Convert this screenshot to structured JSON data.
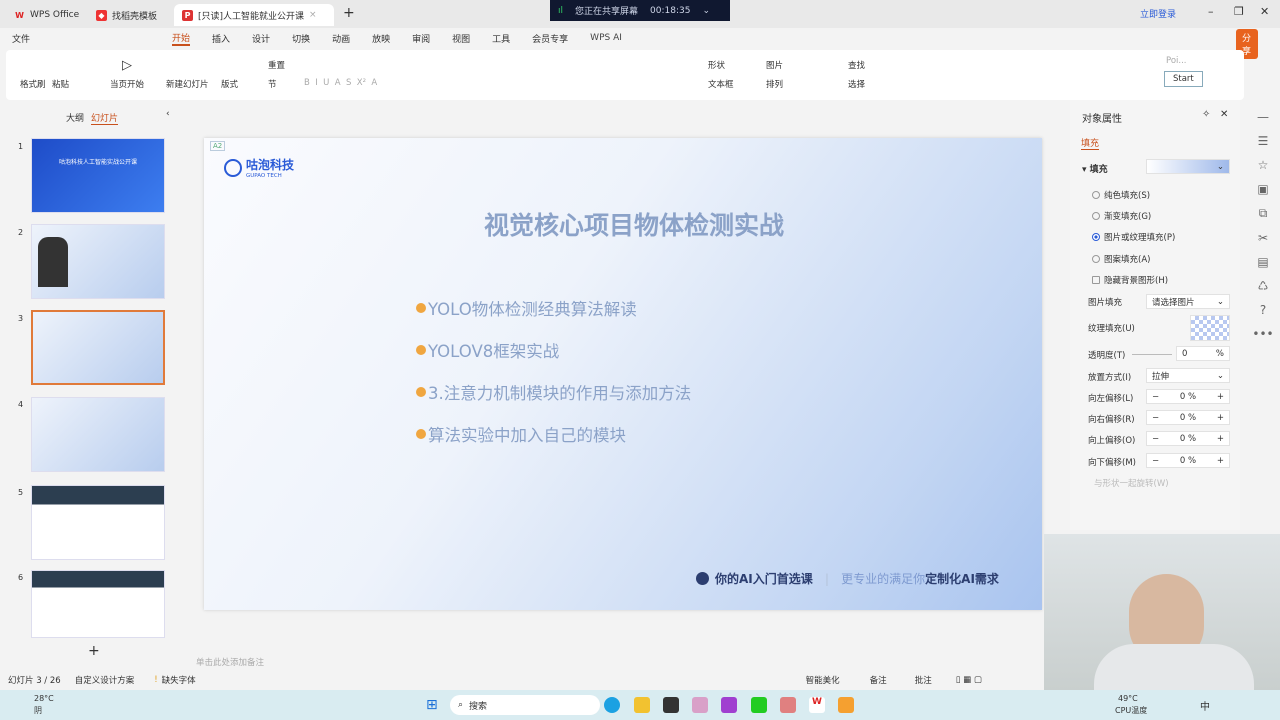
{
  "tabs": [
    {
      "label": "WPS Office",
      "icon": "wps-icon"
    },
    {
      "label": "找稻壳模板",
      "icon": "docer-icon"
    },
    {
      "label": "[只读]人工智能就业公开课",
      "icon": "ppt-icon"
    }
  ],
  "share_bar": {
    "text": "您正在共享屏幕",
    "time": "00:18:35"
  },
  "login": "立即登录",
  "share_button": "分享",
  "menu": [
    "文件",
    "开始",
    "插入",
    "设计",
    "切换",
    "动画",
    "放映",
    "审阅",
    "视图",
    "工具",
    "会员专享",
    "WPS AI"
  ],
  "ribbon": {
    "format_painter": "格式刷",
    "paste": "粘贴",
    "play": "当页开始",
    "new_slide": "新建幻灯片",
    "layout": "版式",
    "reset": "重置",
    "section": "节",
    "shape": "形状",
    "picture": "图片",
    "textbox": "文本框",
    "arrange": "排列",
    "find": "查找",
    "select": "选择",
    "start": "Start",
    "popup": "Poi..."
  },
  "left_panel": {
    "tab_outline": "大纲",
    "tab_slides": "幻灯片",
    "slides": [
      "1",
      "2",
      "3",
      "4",
      "5",
      "6"
    ],
    "thumb1_title": "咕泡科技人工智能实战公开课"
  },
  "slide": {
    "tag": "A2",
    "logo_cn": "咕泡科技",
    "logo_en": "GUPAO TECH",
    "title": "视觉核心项目物体检测实战",
    "bullets": [
      "YOLO物体检测经典算法解读",
      "YOLOV8框架实战",
      "3.注意力机制模块的作用与添加方法",
      "算法实验中加入自己的模块"
    ],
    "footer_left": "你的AI入门首选课",
    "footer_right_a": "更专业的满足你",
    "footer_right_b": "定制化AI需求"
  },
  "notes_placeholder": "单击此处添加备注",
  "right_panel": {
    "title": "对象属性",
    "tab": "填充",
    "section": "填充",
    "options": [
      "纯色填充(S)",
      "渐变填充(G)",
      "图片或纹理填充(P)",
      "图案填充(A)"
    ],
    "selected": 2,
    "hide_bg": "隐藏背景图形(H)",
    "pic_fill": "图片填充",
    "pic_fill_value": "请选择图片",
    "texture": "纹理填充(U)",
    "transparency": "透明度(T)",
    "transparency_value": "0",
    "percent": "%",
    "placement": "放置方式(I)",
    "placement_value": "拉伸",
    "offsets": [
      {
        "label": "向左偏移(L)",
        "value": "0"
      },
      {
        "label": "向右偏移(R)",
        "value": "0"
      },
      {
        "label": "向上偏移(O)",
        "value": "0"
      },
      {
        "label": "向下偏移(M)",
        "value": "0"
      }
    ],
    "rotate": "与形状一起旋转(W)"
  },
  "status": {
    "slide_count": "幻灯片 3 / 26",
    "design": "自定义设计方案",
    "missing_font": "缺失字体",
    "beautify": "智能美化",
    "notes": "备注",
    "comment": "批注"
  },
  "taskbar": {
    "weather_temp": "28°C",
    "weather_desc": "阴",
    "search": "搜索",
    "cpu_temp": "49°C",
    "cpu_label": "CPU温度",
    "ime": "中"
  }
}
